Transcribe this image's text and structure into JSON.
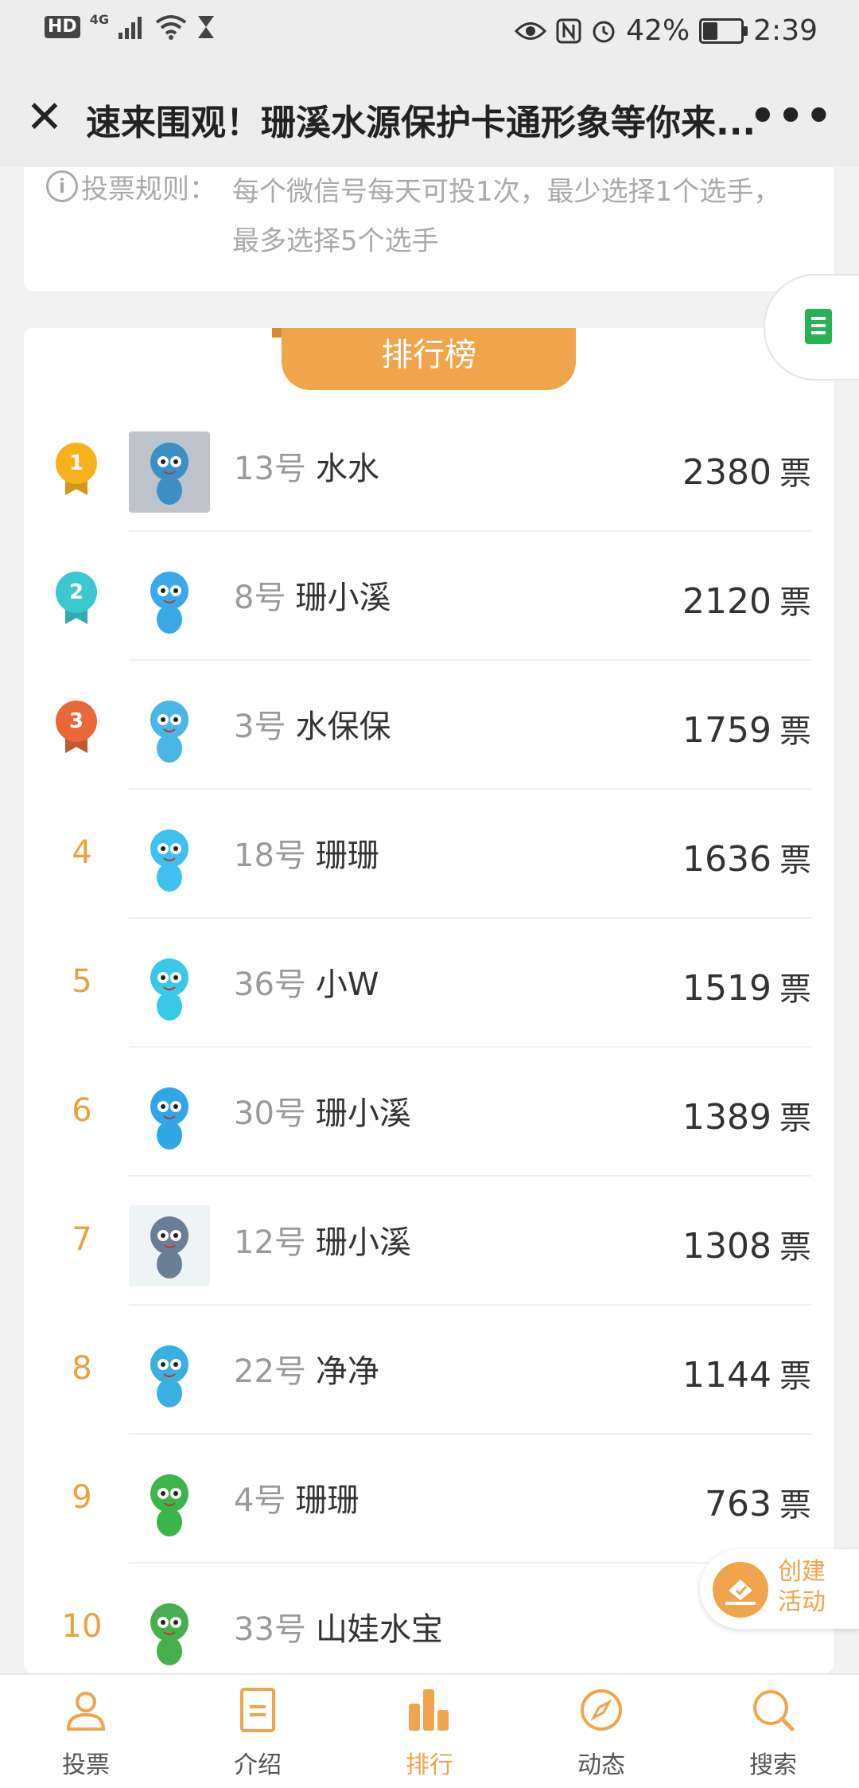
{
  "status_bar": {
    "left_hd": "HD",
    "network": "4G",
    "battery_percent": "42%",
    "battery_level": 0.42,
    "time": "2:39"
  },
  "header": {
    "title": "速来围观！珊溪水源保护卡通形象等你来...",
    "close_icon": "close-icon",
    "more_icon": "more-icon"
  },
  "rules": {
    "label": "投票规则：",
    "text": "每个微信号每天可投1次，最少选择1个选手，最多选择5个选手"
  },
  "ranking": {
    "tab_label": "排行榜",
    "vote_unit": "票",
    "entries": [
      {
        "rank": "1",
        "number": "13号",
        "name": "水水",
        "votes": "2380"
      },
      {
        "rank": "2",
        "number": "8号",
        "name": "珊小溪",
        "votes": "2120"
      },
      {
        "rank": "3",
        "number": "3号",
        "name": "水保保",
        "votes": "1759"
      },
      {
        "rank": "4",
        "number": "18号",
        "name": "珊珊",
        "votes": "1636"
      },
      {
        "rank": "5",
        "number": "36号",
        "name": "小W",
        "votes": "1519"
      },
      {
        "rank": "6",
        "number": "30号",
        "name": "珊小溪",
        "votes": "1389"
      },
      {
        "rank": "7",
        "number": "12号",
        "name": "珊小溪",
        "votes": "1308"
      },
      {
        "rank": "8",
        "number": "22号",
        "name": "净净",
        "votes": "1144"
      },
      {
        "rank": "9",
        "number": "4号",
        "name": "珊珊",
        "votes": "763"
      },
      {
        "rank": "10",
        "number": "33号",
        "name": "山娃水宝",
        "votes": ""
      }
    ]
  },
  "floating": {
    "create_label": "创建活动",
    "doc_icon": "document-icon"
  },
  "bottom_nav": {
    "items": [
      {
        "label": "投票",
        "icon": "user-icon"
      },
      {
        "label": "介绍",
        "icon": "document-icon"
      },
      {
        "label": "排行",
        "icon": "bar-chart-icon"
      },
      {
        "label": "动态",
        "icon": "compass-icon"
      },
      {
        "label": "搜索",
        "icon": "search-icon"
      }
    ],
    "active_index": 2
  },
  "colors": {
    "accent": "#f0a44b",
    "gold": "#f6b21c",
    "silver_teal": "#3cc8d0",
    "bronze": "#e8683a"
  }
}
